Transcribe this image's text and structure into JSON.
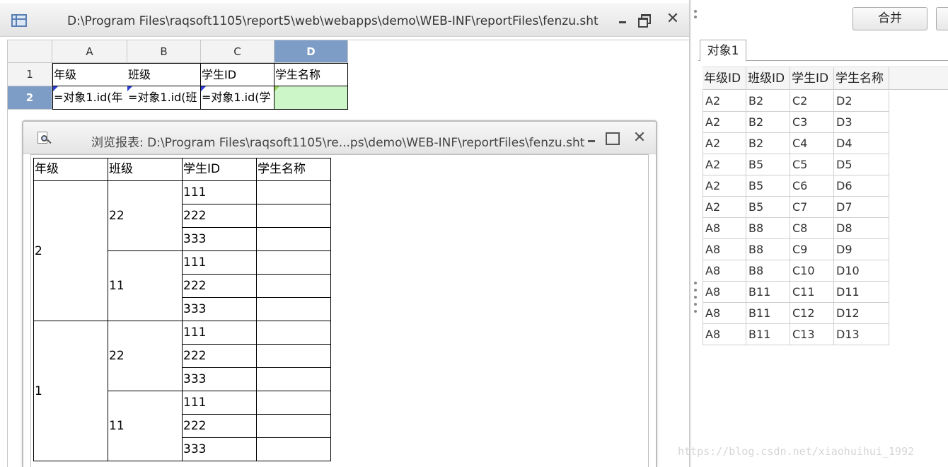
{
  "main_window": {
    "title": "D:\\Program Files\\raqsoft1105\\report5\\web\\webapps\\demo\\WEB-INF\\reportFiles\\fenzu.sht",
    "designer": {
      "column_headers": [
        "A",
        "B",
        "C",
        "D"
      ],
      "selected_column": "D",
      "row_headers": [
        "1",
        "2"
      ],
      "selected_row": "2",
      "rows": [
        [
          "年级",
          "班级",
          "学生ID",
          "学生名称"
        ],
        [
          "=对象1.id(年",
          "=对象1.id(班",
          "=对象1.id(学",
          ""
        ]
      ]
    }
  },
  "preview_window": {
    "title": "浏览报表: D:\\Program Files\\raqsoft1105\\re...ps\\demo\\WEB-INF\\reportFiles\\fenzu.sht",
    "report": {
      "headers": [
        "年级",
        "班级",
        "学生ID",
        "学生名称"
      ],
      "groups": [
        {
          "grade": "2",
          "classes": [
            {
              "class": "22",
              "students": [
                "111",
                "222",
                "333"
              ]
            },
            {
              "class": "11",
              "students": [
                "111",
                "222",
                "333"
              ]
            }
          ]
        },
        {
          "grade": "1",
          "classes": [
            {
              "class": "22",
              "students": [
                "111",
                "222",
                "333"
              ]
            },
            {
              "class": "11",
              "students": [
                "111",
                "222",
                "333"
              ]
            }
          ]
        }
      ]
    }
  },
  "right_panel": {
    "merge_label": "合并",
    "tab_label": "对象1",
    "columns": [
      "年级ID",
      "班级ID",
      "学生ID",
      "学生名称"
    ],
    "rows": [
      [
        "A2",
        "B2",
        "C2",
        "D2"
      ],
      [
        "A2",
        "B2",
        "C3",
        "D3"
      ],
      [
        "A2",
        "B2",
        "C4",
        "D4"
      ],
      [
        "A2",
        "B5",
        "C5",
        "D5"
      ],
      [
        "A2",
        "B5",
        "C6",
        "D6"
      ],
      [
        "A2",
        "B5",
        "C7",
        "D7"
      ],
      [
        "A8",
        "B8",
        "C8",
        "D8"
      ],
      [
        "A8",
        "B8",
        "C9",
        "D9"
      ],
      [
        "A8",
        "B8",
        "C10",
        "D10"
      ],
      [
        "A8",
        "B11",
        "C11",
        "D11"
      ],
      [
        "A8",
        "B11",
        "C12",
        "D12"
      ],
      [
        "A8",
        "B11",
        "C13",
        "D13"
      ]
    ]
  },
  "watermark": "https://blog.csdn.net/xiaohuihui_1992",
  "colors": {
    "selected_header": "#7d9cc6",
    "green_cell": "#ccf5c8",
    "marker_blue": "#2c3fd6",
    "marker_lime": "#9ad25a"
  }
}
